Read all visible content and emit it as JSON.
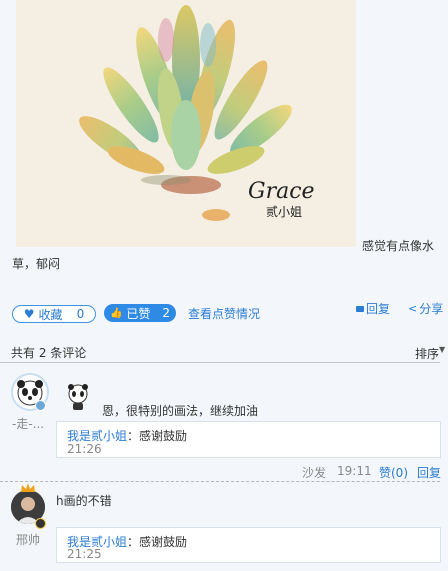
{
  "post": {
    "artwork_signature": "Grace",
    "artwork_author": "贰小姐",
    "caption_line1": "感觉有点像水",
    "caption_line2": "草，郁闷"
  },
  "actions": {
    "favorite_label": "收藏",
    "favorite_count": "0",
    "liked_label": "已赞",
    "liked_count": "2",
    "view_likes_label": "查看点赞情况",
    "reply_label": "回复",
    "share_label": "分享"
  },
  "comments_header": {
    "count_text": "共有 2 条评论",
    "sort_label": "排序"
  },
  "comments": [
    {
      "username": "-走-...",
      "text": "恩，很特别的画法，继续加油",
      "reply_user": "我是贰小姐",
      "reply_text": "：感谢鼓励",
      "reply_time": "21:26",
      "footer_floor": "沙发",
      "footer_time": "19:11",
      "footer_like": "赞(0)",
      "footer_reply": "回复"
    },
    {
      "username": "邢帅",
      "text": "h画的不错",
      "reply_user": "我是贰小姐",
      "reply_text": "：感谢鼓励",
      "reply_time": "21:25"
    }
  ]
}
